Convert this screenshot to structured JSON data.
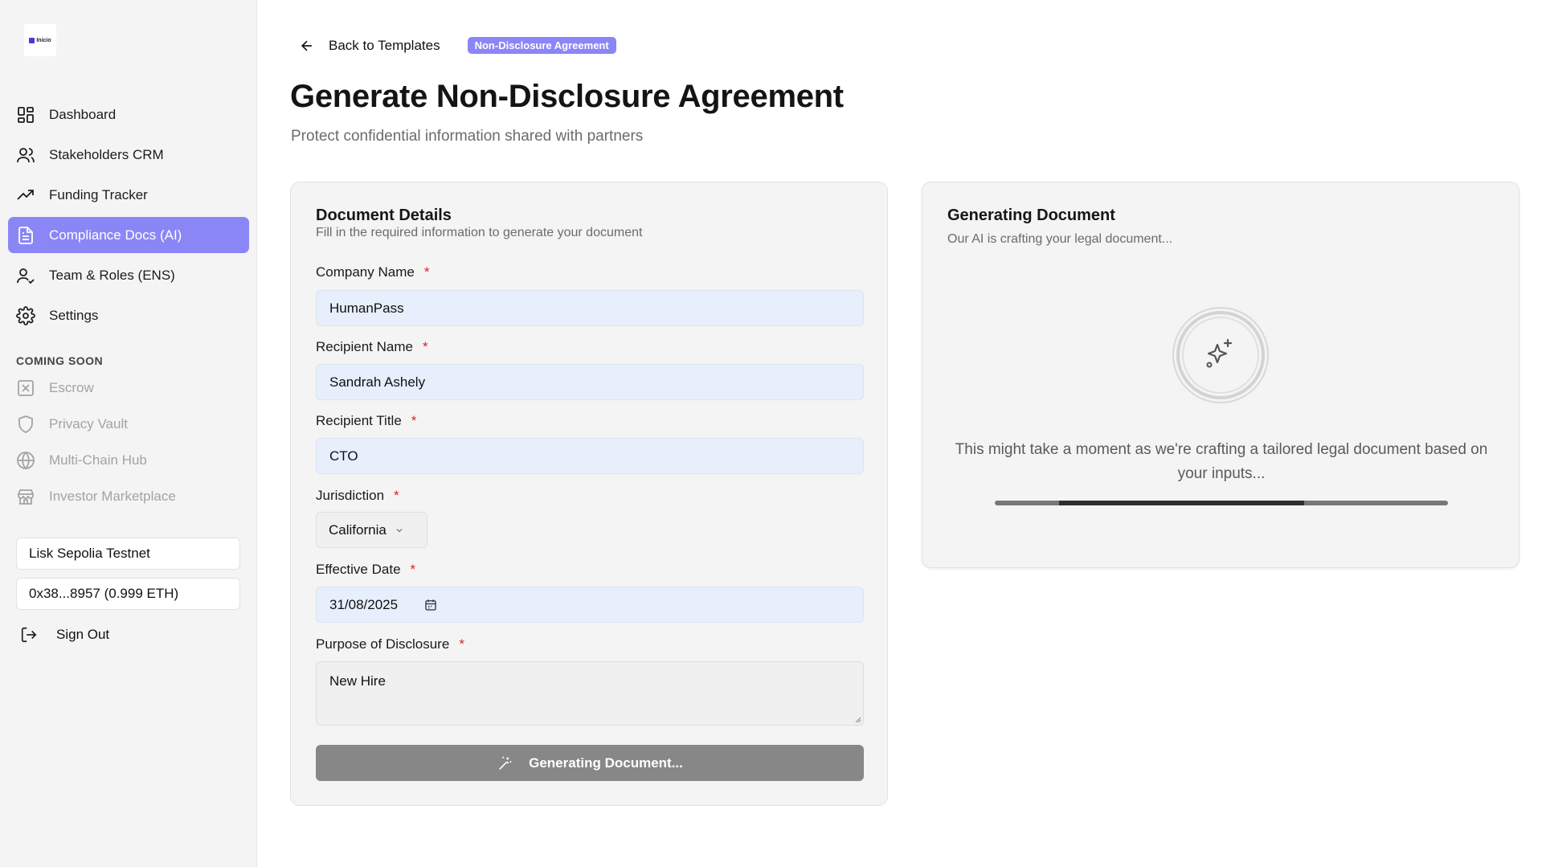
{
  "sidebar": {
    "logo_text": "Inicio",
    "nav": [
      {
        "label": "Dashboard",
        "icon": "dashboard-icon"
      },
      {
        "label": "Stakeholders CRM",
        "icon": "users-icon"
      },
      {
        "label": "Funding Tracker",
        "icon": "trending-up-icon"
      },
      {
        "label": "Compliance Docs (AI)",
        "icon": "document-icon",
        "active": true
      },
      {
        "label": "Team & Roles (ENS)",
        "icon": "user-check-icon"
      },
      {
        "label": "Settings",
        "icon": "gear-icon"
      }
    ],
    "coming_soon_label": "COMING SOON",
    "coming_soon": [
      {
        "label": "Escrow",
        "icon": "escrow-icon"
      },
      {
        "label": "Privacy Vault",
        "icon": "shield-icon"
      },
      {
        "label": "Multi-Chain Hub",
        "icon": "globe-icon"
      },
      {
        "label": "Investor Marketplace",
        "icon": "store-icon"
      }
    ],
    "network": "Lisk Sepolia Testnet",
    "wallet": "0x38...8957 (0.999 ETH)",
    "sign_out": "Sign Out"
  },
  "header": {
    "back_label": "Back to Templates",
    "badge": "Non-Disclosure Agreement",
    "title": "Generate Non-Disclosure Agreement",
    "subtitle": "Protect confidential information shared with partners"
  },
  "form": {
    "title": "Document Details",
    "subtitle": "Fill in the required information to generate your document",
    "required_mark": "*",
    "company_name": {
      "label": "Company Name",
      "value": "HumanPass"
    },
    "recipient_name": {
      "label": "Recipient Name",
      "value": "Sandrah Ashely"
    },
    "recipient_title": {
      "label": "Recipient Title",
      "value": "CTO"
    },
    "jurisdiction": {
      "label": "Jurisdiction",
      "value": "California"
    },
    "effective_date": {
      "label": "Effective Date",
      "value": "31/08/2025"
    },
    "purpose": {
      "label": "Purpose of Disclosure",
      "value": "New Hire"
    },
    "submit_label": "Generating Document..."
  },
  "generating": {
    "title": "Generating Document",
    "subtitle": "Our AI is crafting your legal document...",
    "message": "This might take a moment as we're crafting a tailored legal document based on your inputs...",
    "progress_fraction": 0.54
  },
  "colors": {
    "accent": "#8b86f6",
    "required": "#e11d2e",
    "input_bg": "#e7eefc",
    "button_disabled": "#878787"
  }
}
